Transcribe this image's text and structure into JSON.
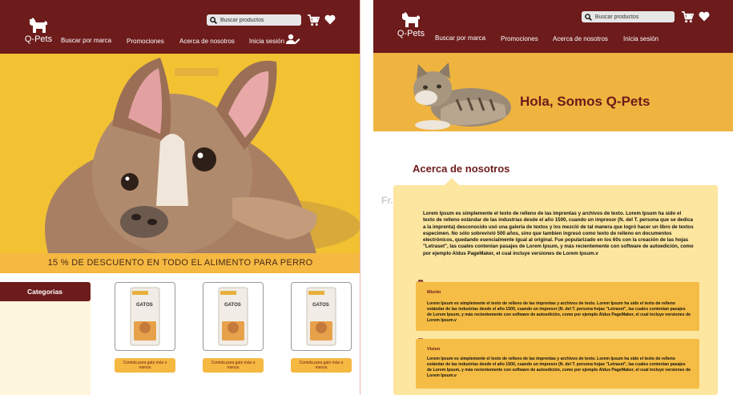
{
  "brand": {
    "logo_text": "Q-Pets"
  },
  "search": {
    "placeholder": "Buscar productos"
  },
  "nav": {
    "brand_search": "Buscar por marca",
    "promotions": "Promociones",
    "about": "Acerca de nosotros",
    "login": "Inicia sesión"
  },
  "home": {
    "promo_banner": "15 % DE DESCUENTO EN TODO EL ALIMENTO PARA PERRO",
    "categories_label": "Categorias",
    "products": [
      {
        "package_label": "GATOS",
        "button_label": "Comida para gato más o menos"
      },
      {
        "package_label": "GATOS",
        "button_label": "Comida para gato más o menos"
      },
      {
        "package_label": "GATOS",
        "button_label": "Comida para gato más o menos"
      }
    ]
  },
  "about_page": {
    "hero_title": "Hola, Somos Q-Pets",
    "section_title": "Acerca de nosotros",
    "ghost_text": "Fr...",
    "intro": "Lorem Ipsum es simplemente el texto de relleno de las imprentas y archivos de texto. Lorem Ipsum ha sido el texto de relleno estándar de las industrias desde el año 1500, cuando un impresor (N. del T. persona que se dedica a la imprenta) desconocido usó una galería de textos y los mezcló de tal manera que logró hacer un libro de textos especimen. No sólo sobrevivió 500 años, sino que tambien ingresó como texto de relleno en documentos electrónicos, quedando esencialmente igual al original. Fue popularizado en los 60s con la creación de las hojas \"Letraset\", las cuales contenian pasajes de Lorem Ipsum, y más recientemente con software de autoedición, como por ejemplo Aldus PageMaker, el cual incluye versiones de Lorem Ipsum.v",
    "mission_title": "Misión",
    "mission_text": "Lorem Ipsum es simplemente el texto de relleno de las imprentas y archivos de texto. Lorem Ipsum ha sido el texto de relleno estándar de las industrias desde el año 1500, cuando un impresor (N. del T. persona hojas \"Letraset\", las cuales contenian pasajes de Lorem Ipsum, y más recientemente con software de autoedición, como por ejemplo Aldus PageMaker, el cual incluye versiones de Lorem Ipsum.v",
    "vision_title": "Vision",
    "vision_text": "Lorem Ipsum es simplemente el texto de relleno de las imprentas y archivos de texto. Lorem Ipsum ha sido el texto de relleno estándar de las industrias desde el año 1500, cuando un impresor (N. del T. persona hojas \"Letraset\", las cuales contenian pasajes de Lorem Ipsum, y más recientemente con software de autoedición, como por ejemplo Aldus PageMaker, el cual incluye versiones de Lorem Ipsum.v"
  },
  "icons": [
    "dog-logo-icon",
    "search-icon",
    "cart-icon",
    "heart-icon",
    "user-edit-icon",
    "paw-icon"
  ],
  "colors": {
    "header": "#6d1b1b",
    "accent": "#f5b841",
    "hero_yellow": "#f2c232",
    "card": "#fde6a0",
    "cream": "#fdf5dc"
  }
}
